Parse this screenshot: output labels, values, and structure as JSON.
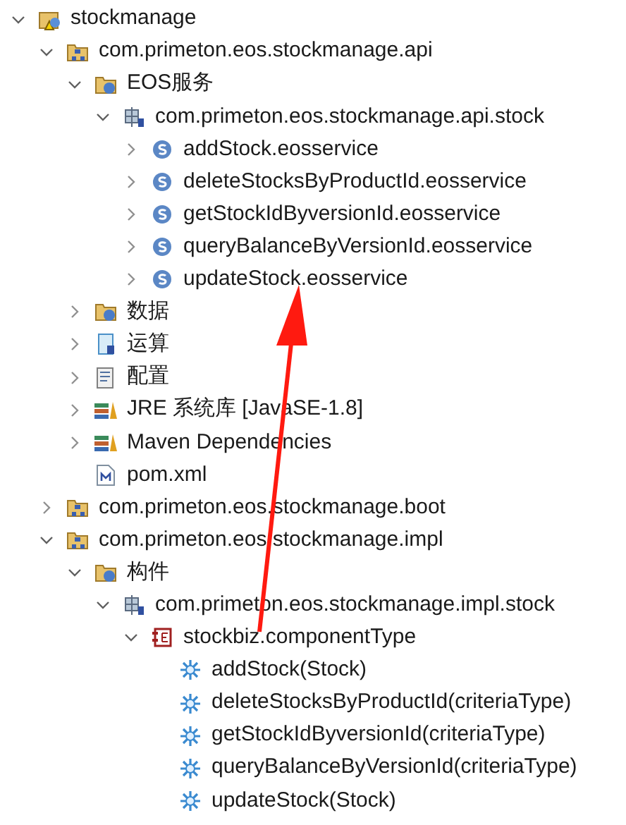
{
  "tree": [
    {
      "label": "stockmanage",
      "kind": "project",
      "expanded": true,
      "children": [
        {
          "label": "com.primeton.eos.stockmanage.api",
          "kind": "module",
          "expanded": true,
          "children": [
            {
              "label": "EOS服务",
              "kind": "folder",
              "expanded": true,
              "children": [
                {
                  "label": "com.primeton.eos.stockmanage.api.stock",
                  "kind": "package",
                  "expanded": true,
                  "children": [
                    {
                      "label": "addStock.eosservice",
                      "kind": "service",
                      "expanded": false
                    },
                    {
                      "label": "deleteStocksByProductId.eosservice",
                      "kind": "service",
                      "expanded": false
                    },
                    {
                      "label": "getStockIdByversionId.eosservice",
                      "kind": "service",
                      "expanded": false
                    },
                    {
                      "label": "queryBalanceByVersionId.eosservice",
                      "kind": "service",
                      "expanded": false
                    },
                    {
                      "label": "updateStock.eosservice",
                      "kind": "service",
                      "expanded": false
                    }
                  ]
                }
              ]
            },
            {
              "label": "数据",
              "kind": "folder",
              "expanded": false
            },
            {
              "label": "运算",
              "kind": "operation",
              "expanded": false
            },
            {
              "label": "配置",
              "kind": "config",
              "expanded": false
            },
            {
              "label": "JRE 系统库 [JavaSE-1.8]",
              "kind": "library",
              "expanded": false
            },
            {
              "label": "Maven Dependencies",
              "kind": "library",
              "expanded": false
            },
            {
              "label": "pom.xml",
              "kind": "pom"
            }
          ]
        },
        {
          "label": "com.primeton.eos.stockmanage.boot",
          "kind": "module",
          "expanded": false
        },
        {
          "label": "com.primeton.eos.stockmanage.impl",
          "kind": "module",
          "expanded": true,
          "children": [
            {
              "label": "构件",
              "kind": "folder",
              "expanded": true,
              "children": [
                {
                  "label": "com.primeton.eos.stockmanage.impl.stock",
                  "kind": "package",
                  "expanded": true,
                  "children": [
                    {
                      "label": "stockbiz.componentType",
                      "kind": "component",
                      "expanded": true,
                      "children": [
                        {
                          "label": "addStock(Stock)",
                          "kind": "method"
                        },
                        {
                          "label": "deleteStocksByProductId(criteriaType)",
                          "kind": "method"
                        },
                        {
                          "label": "getStockIdByversionId(criteriaType)",
                          "kind": "method"
                        },
                        {
                          "label": "queryBalanceByVersionId(criteriaType)",
                          "kind": "method"
                        },
                        {
                          "label": "updateStock(Stock)",
                          "kind": "method"
                        }
                      ]
                    }
                  ]
                }
              ]
            }
          ]
        }
      ]
    }
  ]
}
